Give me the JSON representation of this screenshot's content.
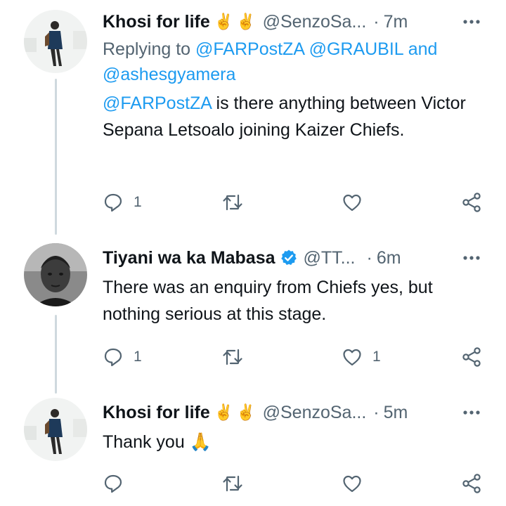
{
  "tweets": [
    {
      "display_name": "Khosi for life",
      "emoji": [
        "✌️",
        "✌️"
      ],
      "verified": false,
      "handle": "@SenzoSa...",
      "separator": "·",
      "time": "7m",
      "replying_prefix": "Replying to",
      "replying_to": [
        "@FARPostZA",
        "@GRAUBIL"
      ],
      "replying_and": "and",
      "replying_last": "@ashesgyamera",
      "mention": "@FARPostZA",
      "text": " is there anything between Victor Sepana Letsoalo joining Kaizer Chiefs.",
      "reply_count": "1",
      "retweet_count": "",
      "like_count": ""
    },
    {
      "display_name": "Tiyani wa ka Mabasa",
      "verified": true,
      "handle": "@TT...",
      "separator": "·",
      "time": "6m",
      "text": "There was an enquiry from Chiefs yes, but nothing serious at this stage.",
      "reply_count": "1",
      "retweet_count": "",
      "like_count": "1"
    },
    {
      "display_name": "Khosi for life",
      "emoji": [
        "✌️",
        "✌️"
      ],
      "verified": false,
      "handle": "@SenzoSa...",
      "separator": "·",
      "time": "5m",
      "text": "Thank you",
      "text_emoji": "🙏",
      "reply_count": "",
      "retweet_count": "",
      "like_count": ""
    }
  ],
  "colors": {
    "link": "#1d9bf0",
    "secondary": "#536471",
    "primary": "#0f1419",
    "thread_line": "#cfd9de",
    "verified": "#1d9bf0"
  },
  "icons": [
    "reply-icon",
    "retweet-icon",
    "like-icon",
    "share-icon",
    "more-icon",
    "verified-icon"
  ]
}
